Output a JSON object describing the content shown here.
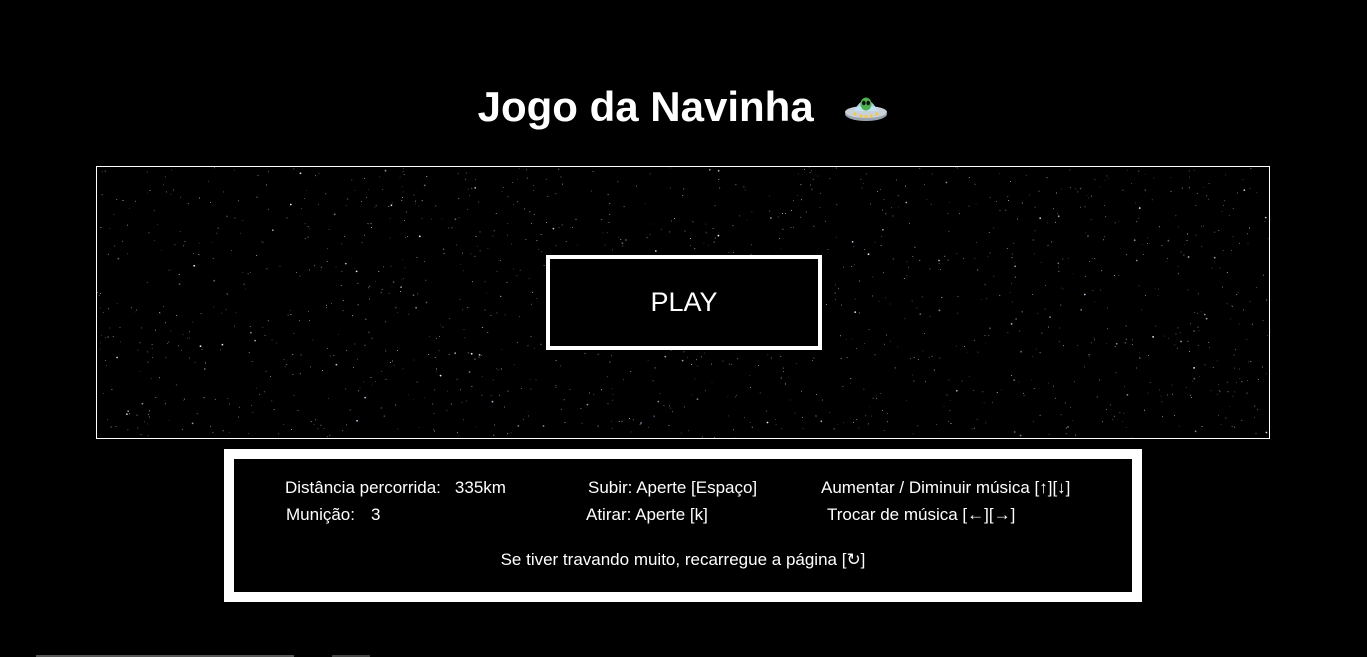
{
  "header": {
    "title": "Jogo da Navinha"
  },
  "game": {
    "play_label": "PLAY"
  },
  "info": {
    "distance_label": "Distância percorrida:",
    "distance_value": "335km",
    "ammo_label": "Munição:",
    "ammo_value": "3",
    "up_control": "Subir: Aperte [Espaço]",
    "shoot_control": "Atirar: Aperte [k]",
    "volume_control": "Aumentar / Diminuir música [↑][↓]",
    "music_control": "Trocar de música [←][→]",
    "reload_hint": "Se tiver travando muito, recarregue a página [↻]"
  },
  "icons": {
    "title_icon": "ufo-alien-icon"
  },
  "colors": {
    "background": "#000000",
    "text": "#ffffff",
    "border": "#ffffff",
    "star": "#c8d0ff"
  }
}
